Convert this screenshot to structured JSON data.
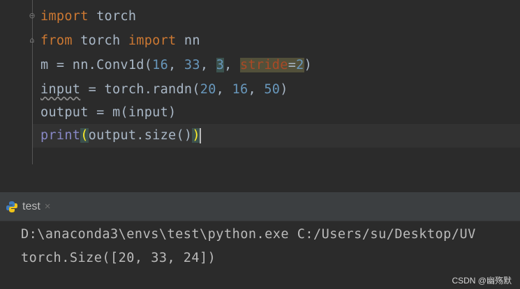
{
  "editor": {
    "lines": [
      {
        "kw": "import",
        "rest": " torch"
      },
      {
        "kw1": "from",
        "mid": " torch ",
        "kw2": "import",
        "rest": " nn"
      },
      {
        "a": "m = nn.Conv1d(",
        "n1": "16",
        "c1": ", ",
        "n2": "33",
        "c2": ", ",
        "n3": "3",
        "c3": ", ",
        "param": "stride",
        "eq": "=",
        "n4": "2",
        "end": ")"
      },
      {
        "var": "input",
        "a": " = torch.randn(",
        "n1": "20",
        "c1": ", ",
        "n2": "16",
        "c2": ", ",
        "n3": "50",
        "end": ")"
      },
      {
        "text": "output = m(input)"
      },
      {
        "fn": "print",
        "open": "(",
        "mid": "output.size()",
        "close": ")"
      }
    ]
  },
  "run_panel": {
    "tab_label": "test",
    "tab_close": "×",
    "icon": "python-icon"
  },
  "console": {
    "lines": [
      "D:\\anaconda3\\envs\\test\\python.exe C:/Users/su/Desktop/UV",
      "torch.Size([20, 33, 24])"
    ]
  },
  "watermark": "CSDN @幽殇默"
}
